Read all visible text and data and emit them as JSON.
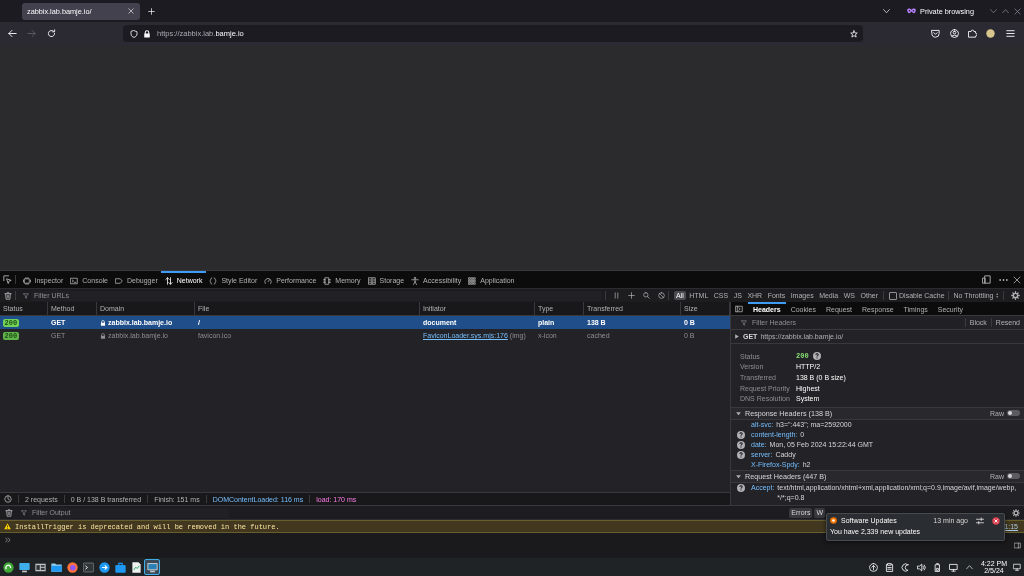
{
  "browser": {
    "tabs": [
      {
        "title": "zabbix.lab.bamje.io/",
        "selected": true
      }
    ],
    "private_label": "Private browsing",
    "back": {
      "disabled": false
    },
    "forward": {
      "disabled": true
    },
    "url": "https://zabbix.lab.**bamje.io**"
  },
  "devtools": {
    "tools": [
      {
        "label": "Inspector",
        "selected": false
      },
      {
        "label": "Console",
        "selected": false
      },
      {
        "label": "Debugger",
        "selected": false
      },
      {
        "label": "Network",
        "selected": true
      },
      {
        "label": "Style Editor",
        "selected": false
      },
      {
        "label": "Performance",
        "selected": false
      },
      {
        "label": "Memory",
        "selected": false
      },
      {
        "label": "Storage",
        "selected": false
      },
      {
        "label": "Accessibility",
        "selected": false
      },
      {
        "label": "Application",
        "selected": false
      }
    ],
    "network": {
      "filter_placeholder": "Filter URLs",
      "type_filters": [
        {
          "label": "All",
          "selected": true
        },
        {
          "label": "HTML",
          "selected": false
        },
        {
          "label": "CSS",
          "selected": false
        },
        {
          "label": "JS",
          "selected": false
        },
        {
          "label": "XHR",
          "selected": false
        },
        {
          "label": "Fonts",
          "selected": false
        },
        {
          "label": "Images",
          "selected": false
        },
        {
          "label": "Media",
          "selected": false
        },
        {
          "label": "WS",
          "selected": false
        },
        {
          "label": "Other",
          "selected": false
        }
      ],
      "disable_cache": {
        "label": "Disable Cache",
        "checked": false
      },
      "throttling": "No Throttling",
      "columns": [
        "Status",
        "Method",
        "Domain",
        "File",
        "Initiator",
        "Type",
        "Transferred",
        "Size"
      ],
      "rows": [
        {
          "status": "200",
          "method": "GET",
          "domain": "zabbix.lab.bamje.io",
          "file": "/",
          "initiator": {
            "text": "document",
            "link": false
          },
          "type": "plain",
          "transferred": "138 B",
          "size": "0 B",
          "selected": true,
          "cached": false
        },
        {
          "status": "200",
          "method": "GET",
          "domain": "zabbix.lab.bamje.io",
          "file": "favicon.ico",
          "initiator": {
            "text": "FaviconLoader.sys.mjs:176",
            "link": true,
            "note": "(img)"
          },
          "type": "x-icon",
          "transferred": "cached",
          "size": "0 B",
          "selected": false,
          "cached": true
        }
      ],
      "summary": [
        {
          "text": "2 requests",
          "kind": "plain"
        },
        {
          "text": "0 B / 138 B transferred",
          "kind": "plain"
        },
        {
          "text": "Finish: 151 ms",
          "kind": "plain"
        },
        {
          "text": "DOMContentLoaded: 116 ms",
          "kind": "dom"
        },
        {
          "text": "load: 170 ms",
          "kind": "load"
        }
      ]
    },
    "sidebar": {
      "tabs": [
        {
          "label": "Headers",
          "selected": true
        },
        {
          "label": "Cookies",
          "selected": false
        },
        {
          "label": "Request",
          "selected": false
        },
        {
          "label": "Response",
          "selected": false
        },
        {
          "label": "Timings",
          "selected": false
        },
        {
          "label": "Security",
          "selected": false
        }
      ],
      "filter_placeholder": "Filter Headers",
      "actions": [
        "Block",
        "Resend"
      ],
      "request": {
        "method": "GET",
        "url": "https://zabbix.lab.bamje.io/",
        "expanded": false
      },
      "summary": [
        {
          "label": "Status",
          "value": "200",
          "kind": "status"
        },
        {
          "label": "Version",
          "value": "HTTP/2",
          "kind": "text"
        },
        {
          "label": "Transferred",
          "value": "138 B (0 B size)",
          "kind": "text"
        },
        {
          "label": "Request Priority",
          "value": "Highest",
          "kind": "text"
        },
        {
          "label": "DNS Resolution",
          "value": "System",
          "kind": "text"
        }
      ],
      "sections": [
        {
          "title": "Response Headers (138 B)",
          "expanded": true,
          "raw_label": "Raw",
          "raw": false,
          "headers": [
            {
              "name": "alt-svc:",
              "value": "h3=\":443\"; ma=2592000",
              "help": false
            },
            {
              "name": "content-length:",
              "value": "0",
              "help": true
            },
            {
              "name": "date:",
              "value": "Mon, 05 Feb 2024 15:22:44 GMT",
              "help": true
            },
            {
              "name": "server:",
              "value": "Caddy",
              "help": true
            },
            {
              "name": "X-Firefox-Spdy:",
              "value": "h2",
              "help": false
            }
          ]
        },
        {
          "title": "Request Headers (447 B)",
          "expanded": true,
          "raw_label": "Raw",
          "raw": false,
          "headers": [
            {
              "name": "Accept:",
              "value": "text/html,application/xhtml+xml,application/xml;q=0.9,image/avif,image/webp,*/*;q=0.8",
              "help": true
            }
          ]
        }
      ]
    },
    "console": {
      "filter_placeholder": "Filter Output",
      "buttons": [
        "Errors",
        "W"
      ],
      "messages": [
        {
          "kind": "warning",
          "text": "InstallTrigger is deprecated and will be removed in the future.",
          "source": "1:15"
        }
      ]
    }
  },
  "notification": {
    "title": "Software Updates",
    "time": "13 min ago",
    "body": "You have 2,339 new updates"
  },
  "taskbar": {
    "apps": [
      {
        "selected": false
      },
      {
        "selected": false
      },
      {
        "selected": false
      },
      {
        "selected": false
      },
      {
        "selected": false
      },
      {
        "selected": false
      },
      {
        "selected": false
      },
      {
        "selected": false
      },
      {
        "selected": false
      },
      {
        "selected": true
      }
    ],
    "time": "4:22 PM",
    "date": "2/5/24"
  }
}
